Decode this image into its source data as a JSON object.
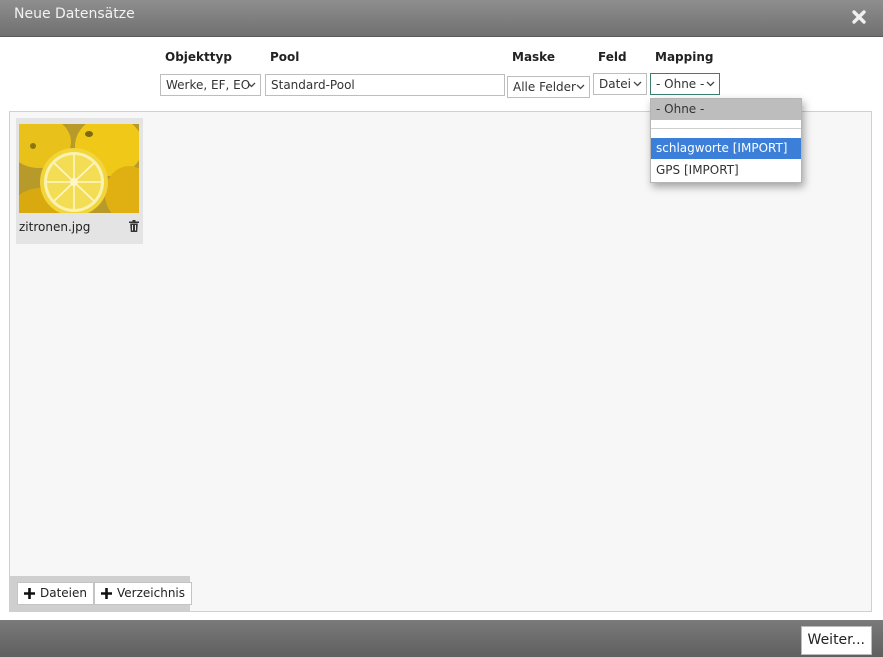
{
  "window": {
    "title": "Neue Datensätze"
  },
  "toolbar": {
    "labels": {
      "objekttyp": "Objekttyp",
      "pool": "Pool",
      "maske": "Maske",
      "feld": "Feld",
      "mapping": "Mapping"
    },
    "objekttyp_value": "Werke, EF, EO",
    "pool_value": "Standard-Pool",
    "maske_value": "Alle Felder",
    "feld_value": "Datei",
    "mapping_value": "- Ohne -"
  },
  "mapping_dropdown": {
    "options": [
      "- Ohne -",
      "schlagworte [IMPORT]",
      "GPS [IMPORT]"
    ],
    "current": "- Ohne -",
    "highlighted": "schlagworte [IMPORT]"
  },
  "files": [
    {
      "name": "zitronen.jpg"
    }
  ],
  "buttons": {
    "add_files": "Dateien",
    "add_directory": "Verzeichnis",
    "next": "Weiter..."
  },
  "colors": {
    "titlebar": "#7f7f7f",
    "highlight": "#3b7fd8",
    "focus_border": "#3a7f6d"
  },
  "icons": {
    "close": "close-icon",
    "chevron": "chevron-down-icon",
    "trash": "trash-icon",
    "plus": "plus-icon"
  }
}
